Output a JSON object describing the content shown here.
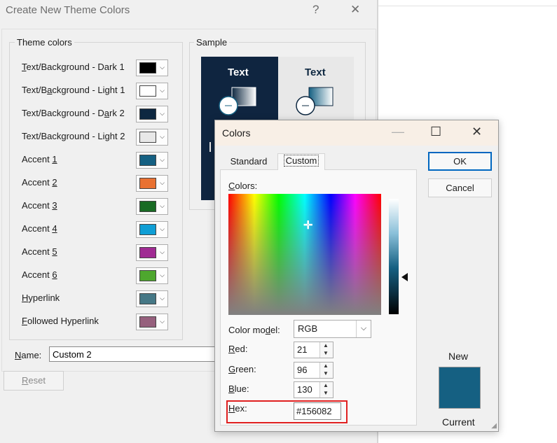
{
  "theme_dialog": {
    "title": "Create New Theme Colors",
    "help_label": "?",
    "close_label": "✕",
    "theme_colors_label": "Theme colors",
    "sample_label": "Sample",
    "rows": [
      {
        "label": "Text/Background - Dark 1",
        "color": "#000000"
      },
      {
        "label": "Text/Background - Light 1",
        "color": "#ffffff"
      },
      {
        "label": "Text/Background - Dark 2",
        "color": "#0e2841"
      },
      {
        "label": "Text/Background - Light 2",
        "color": "#e8e8e8"
      },
      {
        "label": "Accent 1",
        "color": "#156082"
      },
      {
        "label": "Accent 2",
        "color": "#e97132"
      },
      {
        "label": "Accent 3",
        "color": "#196b24"
      },
      {
        "label": "Accent 4",
        "color": "#0f9ed5"
      },
      {
        "label": "Accent 5",
        "color": "#a02b93"
      },
      {
        "label": "Accent 6",
        "color": "#4ea72e"
      },
      {
        "label": "Hyperlink",
        "color": "#467886"
      },
      {
        "label": "Followed Hyperlink",
        "color": "#96607d"
      }
    ],
    "sample": {
      "dark_text": "Text",
      "light_text": "Text"
    },
    "name_label": "Name:",
    "name_value": "Custom 2",
    "reset_label": "Reset"
  },
  "colors_dialog": {
    "title": "Colors",
    "minimize_label": "—",
    "maximize_label": "☐",
    "close_label": "✕",
    "tabs": [
      "Standard",
      "Custom"
    ],
    "active_tab": "Custom",
    "colors_label": "Colors:",
    "color_model_label": "Color model:",
    "color_model_value": "RGB",
    "red_label": "Red:",
    "red_value": "21",
    "green_label": "Green:",
    "green_value": "96",
    "blue_label": "Blue:",
    "blue_value": "130",
    "hex_label": "Hex:",
    "hex_value": "#156082",
    "ok_label": "OK",
    "cancel_label": "Cancel",
    "new_label": "New",
    "current_label": "Current",
    "preview_color": "#156082"
  }
}
